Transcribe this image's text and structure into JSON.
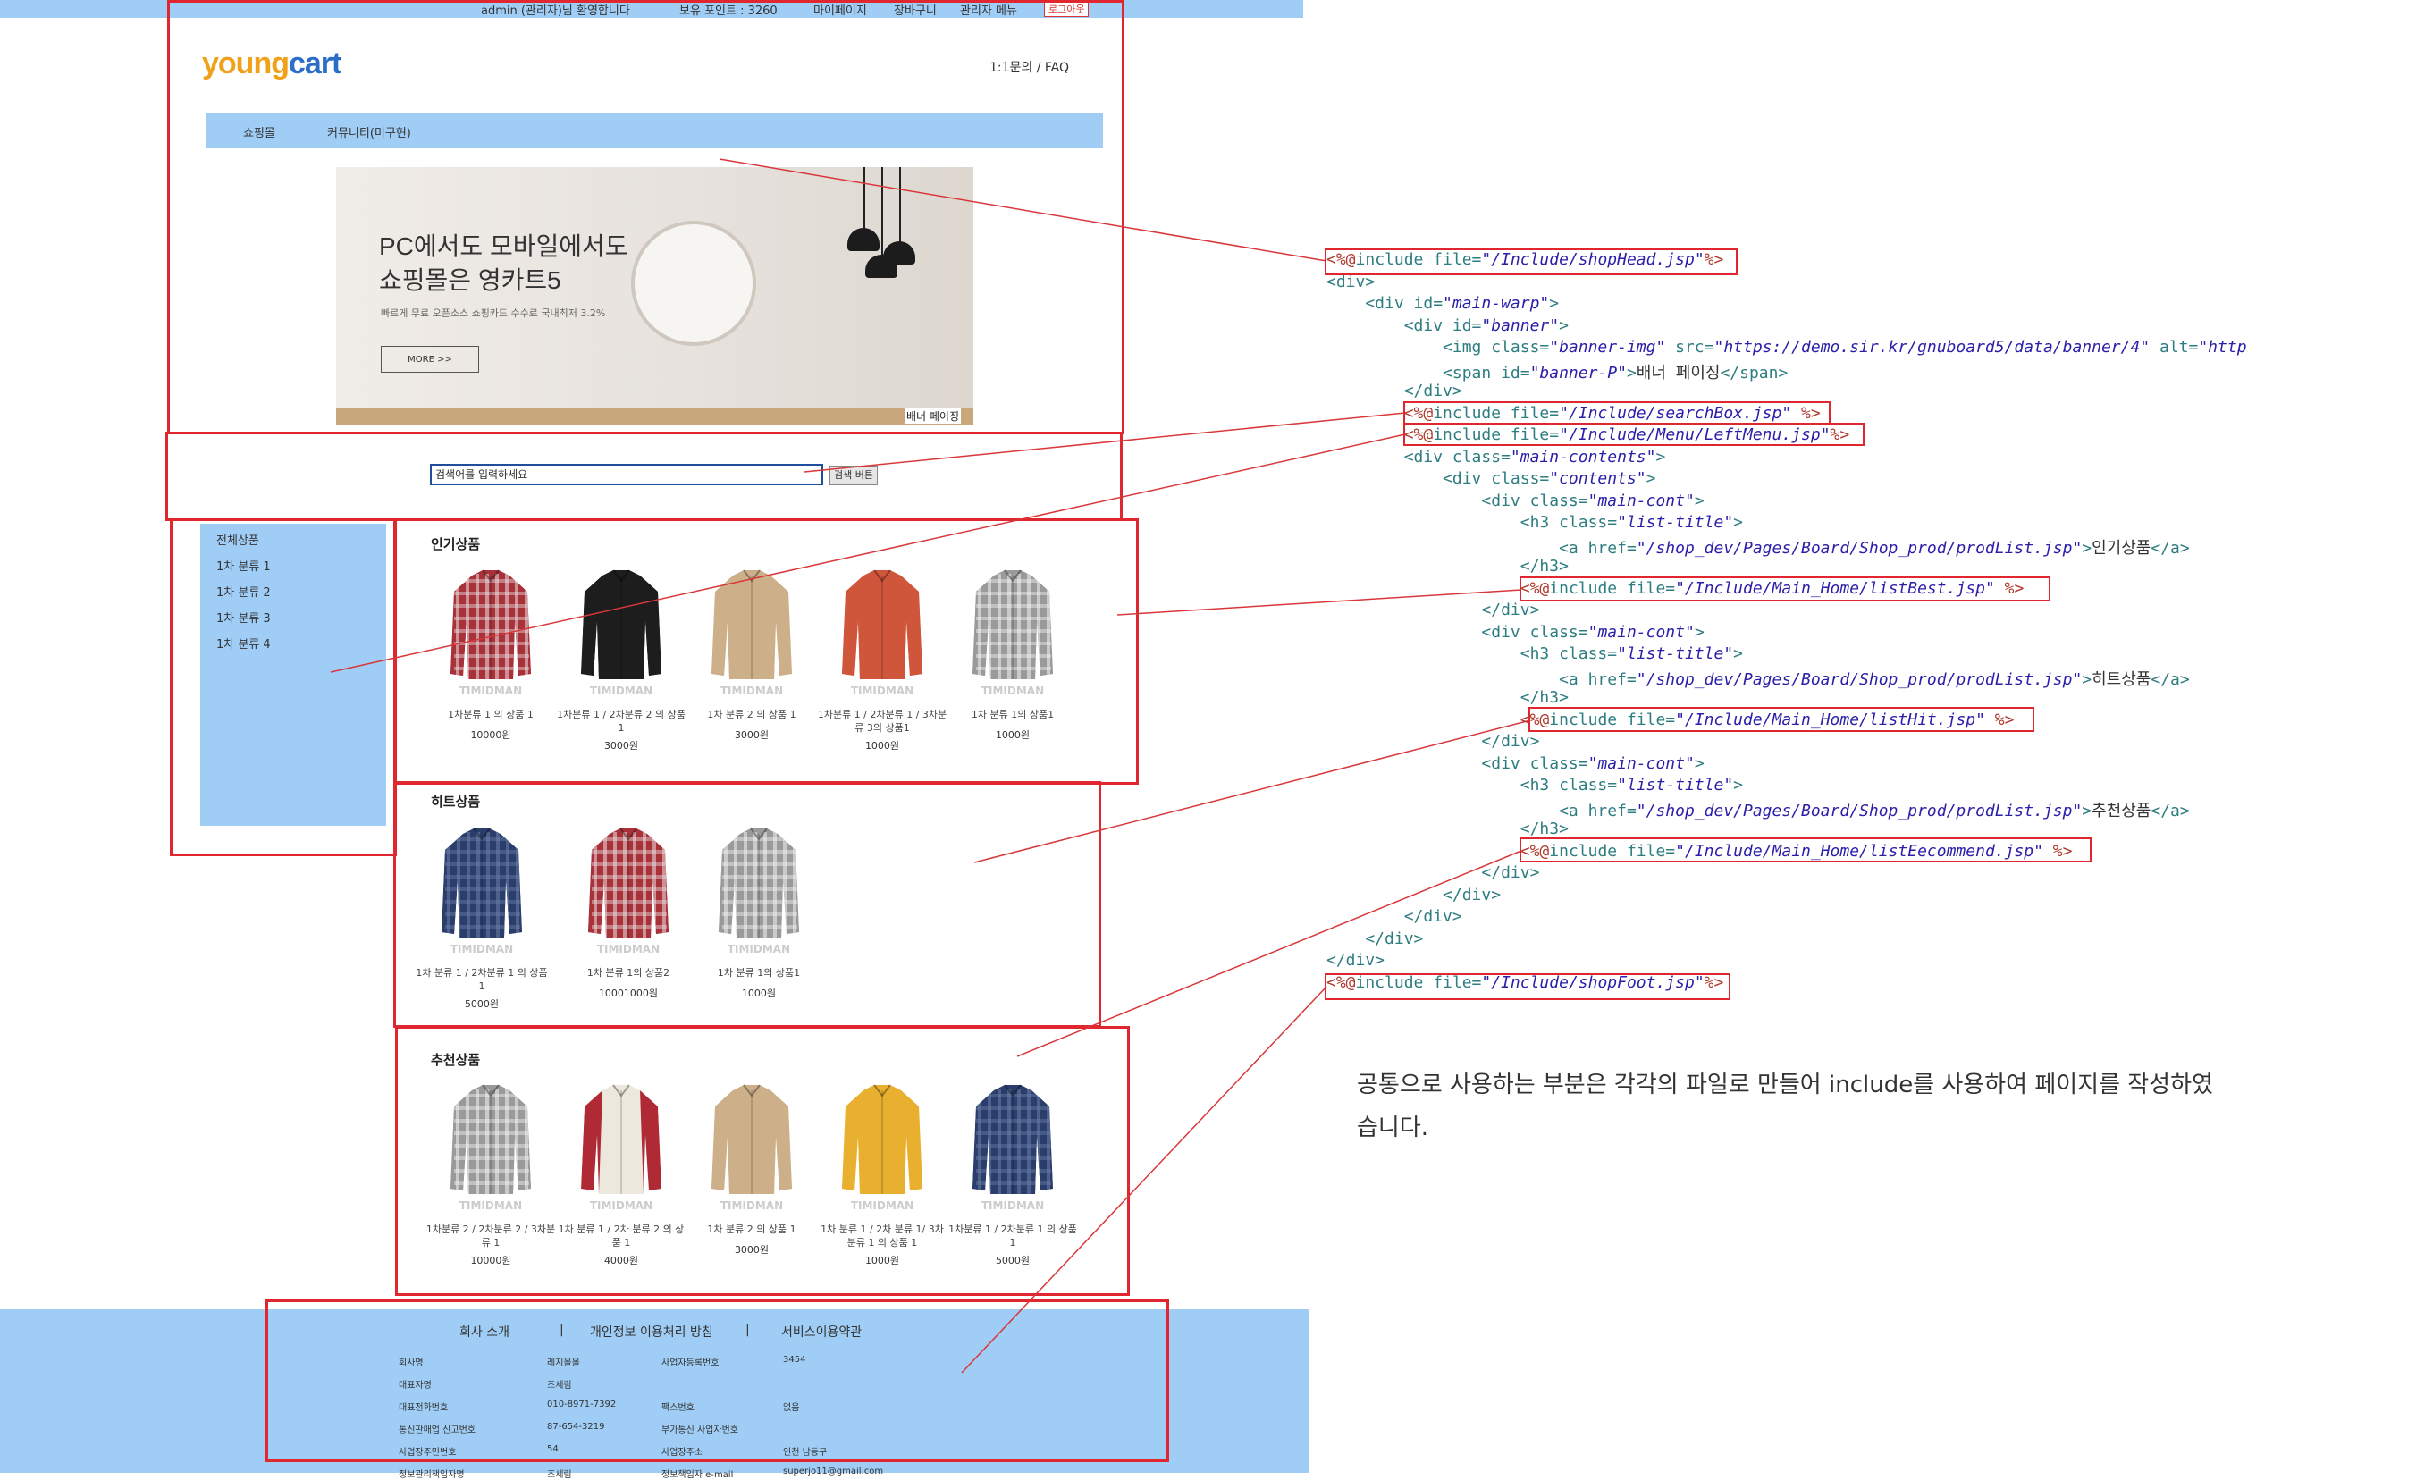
{
  "topbar": {
    "greeting": "admin (관리자)님 환영합니다",
    "points": "보유 포인트 : 3260",
    "mypage": "마이페이지",
    "cart": "장바구니",
    "admin_menu": "관리자 메뉴",
    "logout": "로그아웃"
  },
  "header": {
    "logo_a": "young",
    "logo_b": "cart",
    "help": "1:1문의 / FAQ",
    "menu": [
      "쇼핑몰",
      "커뮤니티(미구현)"
    ]
  },
  "banner": {
    "title_line1": "PC에서도 모바일에서도",
    "title_line2": "쇼핑몰은 영카트5",
    "subtitle": "빠르게 무료 오픈소스 쇼핑카드 수수료 국내최저 3.2%",
    "more": "MORE >>",
    "label": "배너 페이징"
  },
  "search": {
    "placeholder": "검색어를 입력하세요",
    "button": "검색 버튼"
  },
  "left_menu": [
    "전체상품",
    "1차 분류 1",
    "1차 분류 2",
    "1차 분류 3",
    "1차 분류 4"
  ],
  "sections": [
    {
      "title": "인기상품",
      "products": [
        {
          "name": "1차분류 1 의 상품 1",
          "price": "10000원",
          "style": "red-plaid"
        },
        {
          "name": "1차분류 1 / 2차분류 2 의 상품 1",
          "price": "3000원",
          "style": "black"
        },
        {
          "name": "1차 분류 2 의 상품 1",
          "price": "3000원",
          "style": "tan"
        },
        {
          "name": "1차분류 1 / 2차분류 1 / 3차분류 3의 상품1",
          "price": "1000원",
          "style": "orange"
        },
        {
          "name": "1차 분류 1의 상품1",
          "price": "1000원",
          "style": "gray-plaid"
        }
      ]
    },
    {
      "title": "히트상품",
      "products": [
        {
          "name": "1차 분류 1 / 2차분류 1 의 상품1",
          "price": "5000원",
          "style": "navy-plaid"
        },
        {
          "name": "1차 분류 1의 상품2",
          "price": "10001000원",
          "style": "red-plaid"
        },
        {
          "name": "1차 분류 1의 상품1",
          "price": "1000원",
          "style": "gray-plaid"
        }
      ]
    },
    {
      "title": "추천상품",
      "products": [
        {
          "name": "1차분류 2 / 2차분류 2 / 3차분류 1",
          "price": "10000원",
          "style": "gray-plaid"
        },
        {
          "name": "1차 분류 1 / 2차 분류 2 의 상품 1",
          "price": "4000원",
          "style": "raglan"
        },
        {
          "name": "1차 분류 2 의 상품 1",
          "price": "3000원",
          "style": "tan"
        },
        {
          "name": "1차 분류 1 / 2차 분류 1/ 3차 분류 1 의 상품 1",
          "price": "1000원",
          "style": "yellow"
        },
        {
          "name": "1차분류 1 / 2차분류 1 의 상품1",
          "price": "5000원",
          "style": "navy-plaid"
        }
      ]
    }
  ],
  "watermark": "TIMIDMAN",
  "footer": {
    "links": [
      "회사 소개",
      "|",
      "개인정보 이용처리 방침",
      "|",
      "서비스이용약관"
    ],
    "rows": [
      [
        "회사명",
        "레지몰몰",
        "사업자등록번호",
        "3454"
      ],
      [
        "대표자명",
        "조세림",
        "",
        ""
      ],
      [
        "대표전화번호",
        "010-8971-7392",
        "팩스번호",
        "없음"
      ],
      [
        "통신판매업 신고번호",
        "87-654-3219",
        "부가통신 사업자번호",
        ""
      ],
      [
        "사업장주민번호",
        "54",
        "사업장주소",
        "인천 남동구"
      ],
      [
        "정보관리책임자명",
        "조세림",
        "정보책임자 e-mail",
        "superjo11@gmail.com"
      ]
    ]
  },
  "code": [
    {
      "parts": [
        [
          "dir",
          "<%@"
        ],
        [
          "kw",
          "include file="
        ],
        [
          "str",
          "\"/Include/shopHead.jsp\""
        ],
        [
          "dir",
          "%>"
        ]
      ]
    },
    {
      "parts": [
        [
          "kw",
          "<div>"
        ]
      ]
    },
    {
      "parts": [
        [
          "kw",
          "    <div id="
        ],
        [
          "str",
          "\"main-warp\""
        ],
        [
          "kw",
          ">"
        ]
      ]
    },
    {
      "parts": [
        [
          "kw",
          "        <div id="
        ],
        [
          "str",
          "\"banner\""
        ],
        [
          "kw",
          ">"
        ]
      ]
    },
    {
      "parts": [
        [
          "kw",
          "            <img class="
        ],
        [
          "str",
          "\"banner-img\""
        ],
        [
          "kw",
          " src="
        ],
        [
          "str",
          "\"https://demo.sir.kr/gnuboard5/data/banner/4\""
        ],
        [
          "kw",
          " alt="
        ],
        [
          "str",
          "\"http"
        ]
      ]
    },
    {
      "parts": [
        [
          "kw",
          "            <span id="
        ],
        [
          "str",
          "\"banner-P\""
        ],
        [
          "kw",
          ">"
        ],
        [
          "txt",
          "배너 페이징"
        ],
        [
          "kw",
          "</span>"
        ]
      ]
    },
    {
      "parts": [
        [
          "kw",
          "        </div>"
        ]
      ]
    },
    {
      "parts": [
        [
          "kw",
          "        "
        ],
        [
          "dir",
          "<%@"
        ],
        [
          "kw",
          "include file="
        ],
        [
          "str",
          "\"/Include/searchBox.jsp\" "
        ],
        [
          "dir",
          "%>"
        ]
      ]
    },
    {
      "parts": [
        [
          "kw",
          "        "
        ],
        [
          "dir",
          "<%@"
        ],
        [
          "kw",
          "include file="
        ],
        [
          "str",
          "\"/Include/Menu/LeftMenu.jsp\""
        ],
        [
          "dir",
          "%>"
        ]
      ]
    },
    {
      "parts": [
        [
          "kw",
          "        <div class="
        ],
        [
          "str",
          "\"main-contents\""
        ],
        [
          "kw",
          ">"
        ]
      ]
    },
    {
      "parts": [
        [
          "kw",
          "            <div class="
        ],
        [
          "str",
          "\"contents\""
        ],
        [
          "kw",
          ">"
        ]
      ]
    },
    {
      "parts": [
        [
          "kw",
          "                <div class="
        ],
        [
          "str",
          "\"main-cont\""
        ],
        [
          "kw",
          ">"
        ]
      ]
    },
    {
      "parts": [
        [
          "kw",
          "                    <h3 class="
        ],
        [
          "str",
          "\"list-title\""
        ],
        [
          "kw",
          ">"
        ]
      ]
    },
    {
      "parts": [
        [
          "kw",
          "                        <a href="
        ],
        [
          "str",
          "\"/shop_dev/Pages/Board/Shop_prod/prodList.jsp\""
        ],
        [
          "kw",
          ">"
        ],
        [
          "txt",
          "인기상품"
        ],
        [
          "kw",
          "</a>"
        ]
      ]
    },
    {
      "parts": [
        [
          "kw",
          "                    </h3>"
        ]
      ]
    },
    {
      "parts": [
        [
          "kw",
          "                    "
        ],
        [
          "dir",
          "<%@"
        ],
        [
          "kw",
          "include file="
        ],
        [
          "str",
          "\"/Include/Main_Home/listBest.jsp\" "
        ],
        [
          "dir",
          "%>"
        ]
      ]
    },
    {
      "parts": [
        [
          "kw",
          "                </div>"
        ]
      ]
    },
    {
      "parts": [
        [
          "kw",
          "                <div class="
        ],
        [
          "str",
          "\"main-cont\""
        ],
        [
          "kw",
          ">"
        ]
      ]
    },
    {
      "parts": [
        [
          "kw",
          "                    <h3 class="
        ],
        [
          "str",
          "\"list-title\""
        ],
        [
          "kw",
          ">"
        ]
      ]
    },
    {
      "parts": [
        [
          "kw",
          "                        <a href="
        ],
        [
          "str",
          "\"/shop_dev/Pages/Board/Shop_prod/prodList.jsp\""
        ],
        [
          "kw",
          ">"
        ],
        [
          "txt",
          "히트상품"
        ],
        [
          "kw",
          "</a>"
        ]
      ]
    },
    {
      "parts": [
        [
          "kw",
          "                    </h3>"
        ]
      ]
    },
    {
      "parts": [
        [
          "kw",
          "                    "
        ],
        [
          "dir",
          "<%@"
        ],
        [
          "kw",
          "include file="
        ],
        [
          "str",
          "\"/Include/Main_Home/listHit.jsp\" "
        ],
        [
          "dir",
          "%>"
        ]
      ]
    },
    {
      "parts": [
        [
          "kw",
          "                </div>"
        ]
      ]
    },
    {
      "parts": [
        [
          "kw",
          "                <div class="
        ],
        [
          "str",
          "\"main-cont\""
        ],
        [
          "kw",
          ">"
        ]
      ]
    },
    {
      "parts": [
        [
          "kw",
          "                    <h3 class="
        ],
        [
          "str",
          "\"list-title\""
        ],
        [
          "kw",
          ">"
        ]
      ]
    },
    {
      "parts": [
        [
          "kw",
          "                        <a href="
        ],
        [
          "str",
          "\"/shop_dev/Pages/Board/Shop_prod/prodList.jsp\""
        ],
        [
          "kw",
          ">"
        ],
        [
          "txt",
          "추천상품"
        ],
        [
          "kw",
          "</a>"
        ]
      ]
    },
    {
      "parts": [
        [
          "kw",
          "                    </h3>"
        ]
      ]
    },
    {
      "parts": [
        [
          "kw",
          "                    "
        ],
        [
          "dir",
          "<%@"
        ],
        [
          "kw",
          "include file="
        ],
        [
          "str",
          "\"/Include/Main_Home/listEecommend.jsp\" "
        ],
        [
          "dir",
          "%>"
        ]
      ]
    },
    {
      "parts": [
        [
          "kw",
          "                </div>"
        ]
      ]
    },
    {
      "parts": [
        [
          "kw",
          "            </div>"
        ]
      ]
    },
    {
      "parts": [
        [
          "kw",
          "        </div>"
        ]
      ]
    },
    {
      "parts": [
        [
          "kw",
          "    </div>"
        ]
      ]
    },
    {
      "parts": [
        [
          "kw",
          "</div>"
        ]
      ]
    },
    {
      "parts": [
        [
          "dir",
          "<%@"
        ],
        [
          "kw",
          "include file="
        ],
        [
          "str",
          "\"/Include/shopFoot.jsp\""
        ],
        [
          "dir",
          "%>"
        ]
      ]
    }
  ],
  "note": "공통으로 사용하는 부분은 각각의 파일로 만들어 include를 사용하여 페이지를 작성하였습니다.",
  "colors": {
    "accent_blue": "#9fcdf5",
    "highlight_red": "#e0262e",
    "logo_orange": "#f0a019"
  }
}
